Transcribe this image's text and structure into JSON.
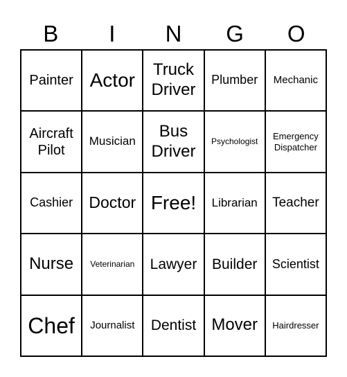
{
  "header": [
    "B",
    "I",
    "N",
    "G",
    "O"
  ],
  "cells": [
    [
      "Painter",
      "Actor",
      "Truck Driver",
      "Plumber",
      "Mechanic"
    ],
    [
      "Aircraft Pilot",
      "Musician",
      "Bus Driver",
      "Psychologist",
      "Emergency Dispatcher"
    ],
    [
      "Cashier",
      "Doctor",
      "Free!",
      "Librarian",
      "Teacher"
    ],
    [
      "Nurse",
      "Veterinarian",
      "Lawyer",
      "Builder",
      "Scientist"
    ],
    [
      "Chef",
      "Journalist",
      "Dentist",
      "Mover",
      "Hairdresser"
    ]
  ]
}
